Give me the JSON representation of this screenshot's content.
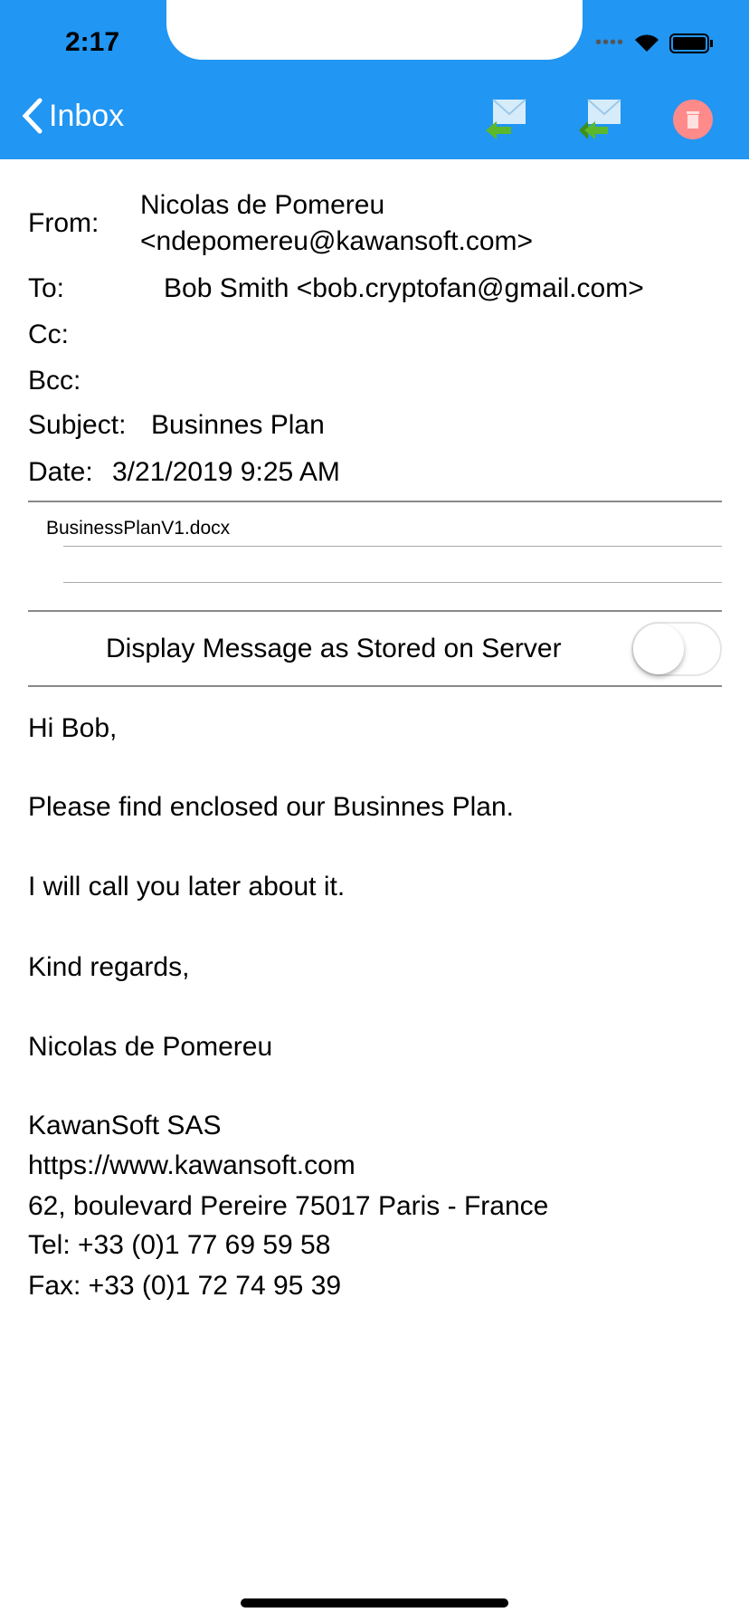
{
  "status": {
    "time": "2:17"
  },
  "nav": {
    "back_label": "Inbox",
    "colors": {
      "bar": "#2196f3",
      "delete": "#ff8a8a"
    }
  },
  "header": {
    "from_label": "From:",
    "from_name": "Nicolas de Pomereu",
    "from_email": "<ndepomereu@kawansoft.com>",
    "to_label": "To:",
    "to_value": "Bob Smith <bob.cryptofan@gmail.com>",
    "cc_label": "Cc:",
    "bcc_label": "Bcc:",
    "subject_label": "Subject:",
    "subject_value": "Businnes Plan",
    "date_label": "Date:",
    "date_value": "3/21/2019 9:25 AM"
  },
  "attachments": [
    "BusinessPlanV1.docx"
  ],
  "toggle": {
    "label": "Display Message as Stored on Server",
    "on": false
  },
  "body": [
    "Hi Bob,",
    "Please find enclosed our Businnes Plan.",
    "I will call you later about it.",
    "Kind regards,",
    "Nicolas de Pomereu",
    "KawanSoft SAS",
    "https://www.kawansoft.com",
    "62, boulevard Pereire 75017 Paris - France",
    "Tel: +33 (0)1 77 69 59 58",
    "Fax: +33 (0)1 72 74 95 39"
  ]
}
